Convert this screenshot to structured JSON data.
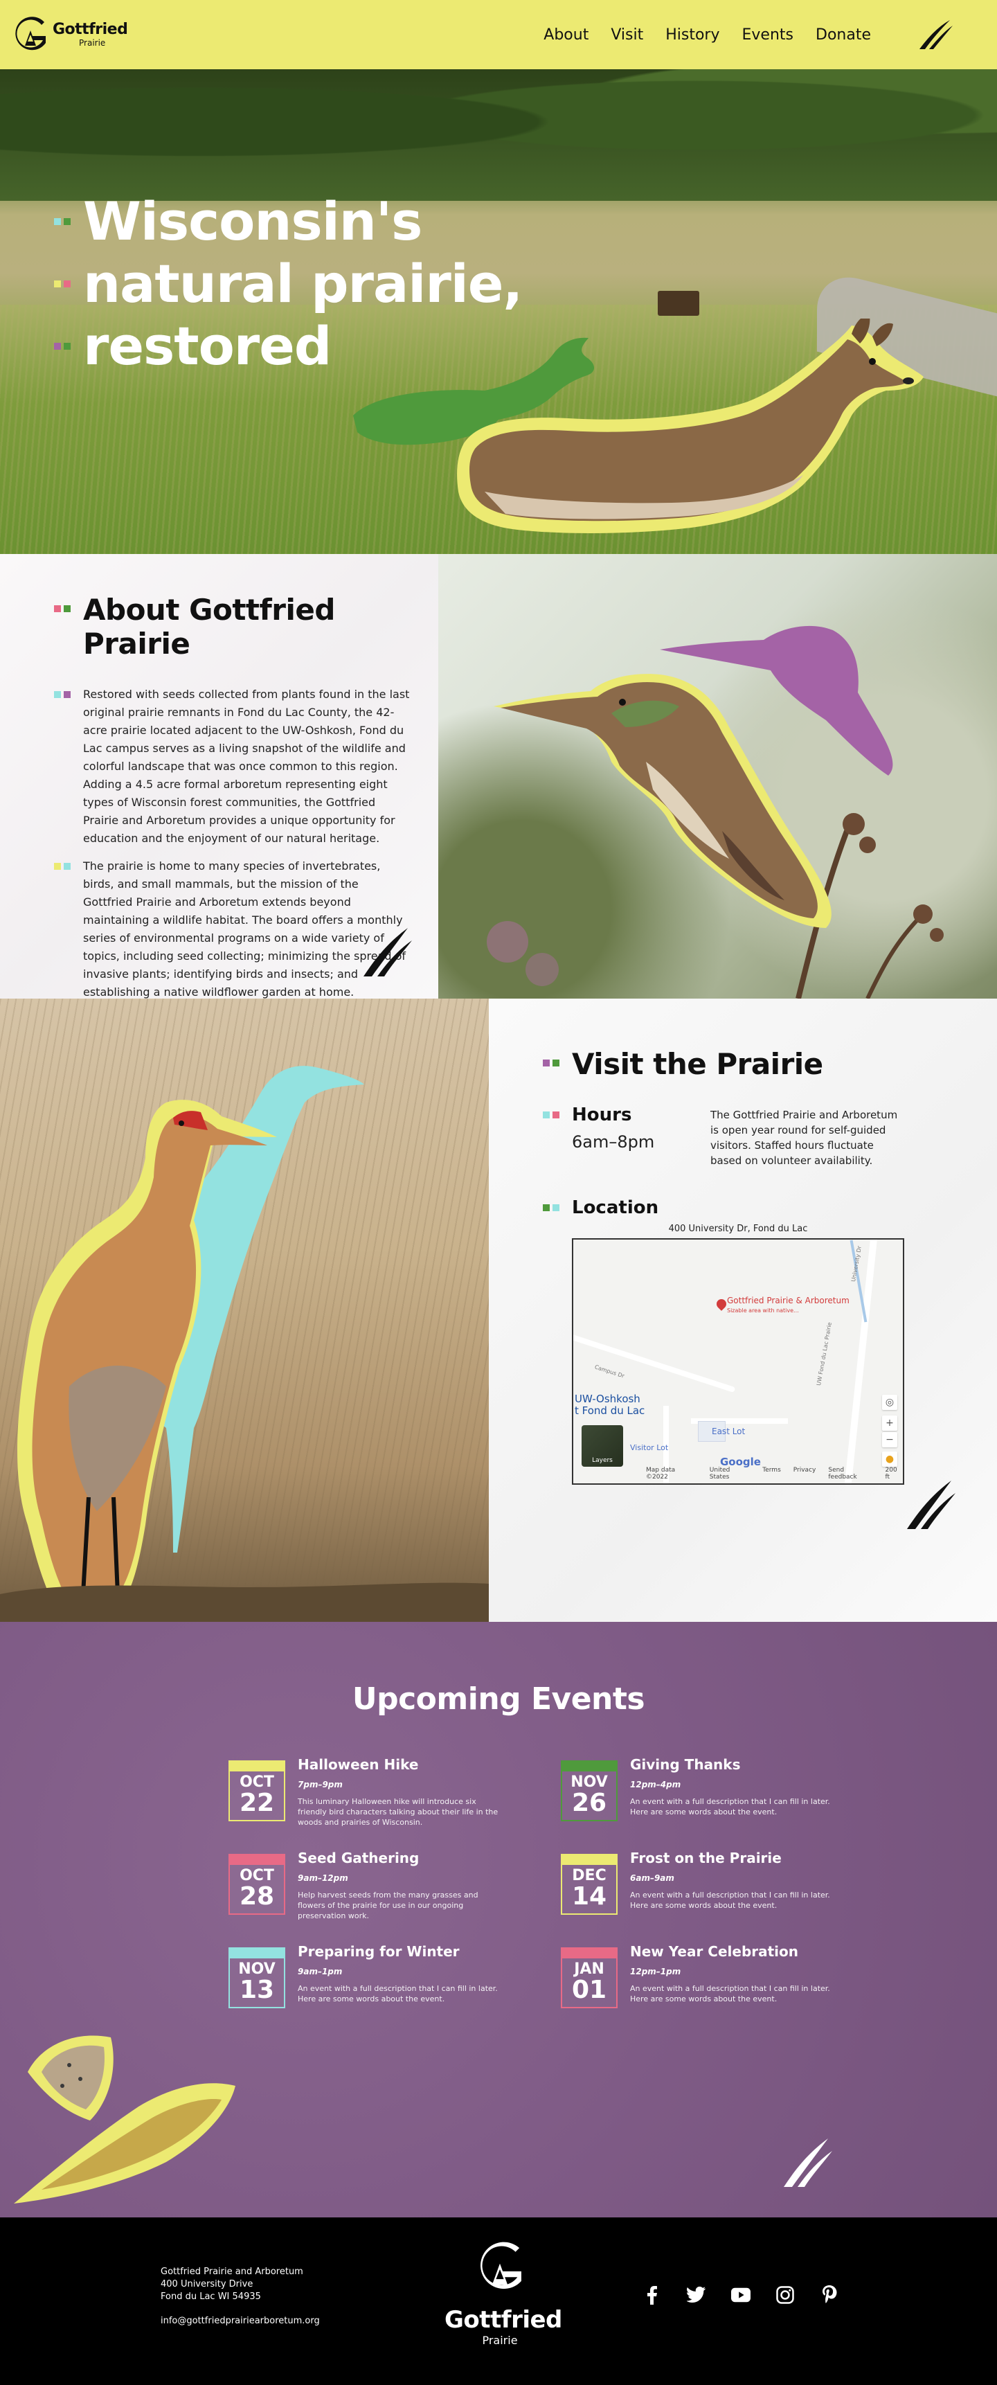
{
  "brand": {
    "name": "Gottfried",
    "sub": "Prairie",
    "colors": {
      "yellow": "#ecea72",
      "purple": "#7f5b86",
      "green": "#4f9a3c",
      "pink": "#e86a86",
      "cyan": "#93e2e0",
      "magenta": "#a463a6"
    }
  },
  "nav": {
    "links": [
      {
        "label": "About"
      },
      {
        "label": "Visit"
      },
      {
        "label": "History"
      },
      {
        "label": "Events"
      },
      {
        "label": "Donate"
      }
    ]
  },
  "hero": {
    "lines": [
      "Wisconsin's",
      "natural prairie,",
      "restored"
    ],
    "bullet_colors": [
      [
        "#93e2e0",
        "#4f9a3c"
      ],
      [
        "#ecea72",
        "#e86a86"
      ],
      [
        "#a463a6",
        "#4f9a3c"
      ]
    ]
  },
  "about": {
    "title": "About Gottfried Prairie",
    "paragraphs": [
      "Restored with seeds collected from plants found in the last original prairie remnants in Fond du Lac County, the 42-acre prairie located adjacent to the UW-Oshkosh, Fond du Lac campus serves as a living snapshot of the wildlife and colorful landscape that was once common to this region. Adding a 4.5 acre formal arboretum representing eight types of Wisconsin forest communities, the Gottfried Prairie and Arboretum provides a unique opportunity for education and the enjoyment of our natural heritage.",
      "The prairie is home to many species of invertebrates, birds, and small mammals, but the mission of the Gottfried Prairie and Arboretum extends beyond maintaining a wildlife habitat. The board offers a monthly series of environmental programs on a wide variety of topics, including seed collecting; minimizing the spread of invasive plants; identifying birds and insects; and establishing a native wildflower garden at home."
    ]
  },
  "visit": {
    "title": "Visit the Prairie",
    "hours_label": "Hours",
    "hours_value": "6am–8pm",
    "hours_desc": "The Gottfried Prairie and Arboretum is open year round for self-guided visitors. Staffed hours fluctuate based on volunteer availability.",
    "location_label": "Location",
    "address": "400 University Dr, Fond du Lac",
    "map": {
      "pin_label": "Gottfried Prairie & Arboretum",
      "pin_sub": "Sizable area with native...",
      "uw_label": "UW-Oshkosh",
      "uw_label2": "t Fond du Lac",
      "visitor_lot": "Visitor Lot",
      "east_lot": "East Lot",
      "layers": "Layers",
      "google": "Google",
      "footer": [
        "Map data ©2022",
        "United States",
        "Terms",
        "Privacy",
        "Send feedback",
        "200 ft"
      ],
      "road_label": "UW Fond du Lac Prairie",
      "road_label2": "University Dr",
      "road_label3": "Campus Dr"
    }
  },
  "events": {
    "title": "Upcoming Events",
    "items": [
      {
        "month": "OCT",
        "day": "22",
        "title": "Halloween Hike",
        "time": "7pm–9pm",
        "desc": "This luminary Halloween hike will introduce six friendly bird characters talking about their life in the woods and prairies of Wisconsin.",
        "color": "#ecea72"
      },
      {
        "month": "NOV",
        "day": "26",
        "title": "Giving Thanks",
        "time": "12pm–4pm",
        "desc": "An event with a full description that I can fill in later. Here are some words about the event.",
        "color": "#4f9a3c"
      },
      {
        "month": "OCT",
        "day": "28",
        "title": "Seed Gathering",
        "time": "9am–12pm",
        "desc": "Help harvest seeds from the many grasses and flowers of the prairie for use in our ongoing preservation work.",
        "color": "#e86a86"
      },
      {
        "month": "DEC",
        "day": "14",
        "title": "Frost on the Prairie",
        "time": "6am–9am",
        "desc": "An event with a full description that I can fill in later. Here are some words about the event.",
        "color": "#ecea72"
      },
      {
        "month": "NOV",
        "day": "13",
        "title": "Preparing for Winter",
        "time": "9am–1pm",
        "desc": "An event with a full description that I can fill in later. Here are some words about the event.",
        "color": "#93e2e0"
      },
      {
        "month": "JAN",
        "day": "01",
        "title": "New Year Celebration",
        "time": "12pm–1pm",
        "desc": "An event with a full description that I can fill in later. Here are some words about the event.",
        "color": "#e86a86"
      }
    ]
  },
  "footer": {
    "address_lines": [
      "Gottfried Prairie and Arboretum",
      "400 University Drive",
      "Fond du Lac WI 54935"
    ],
    "email": "info@gottfriedprairiearboretum.org",
    "logo_name": "Gottfried",
    "logo_sub": "Prairie",
    "social": [
      "facebook-icon",
      "twitter-icon",
      "youtube-icon",
      "instagram-icon",
      "pinterest-icon"
    ]
  }
}
